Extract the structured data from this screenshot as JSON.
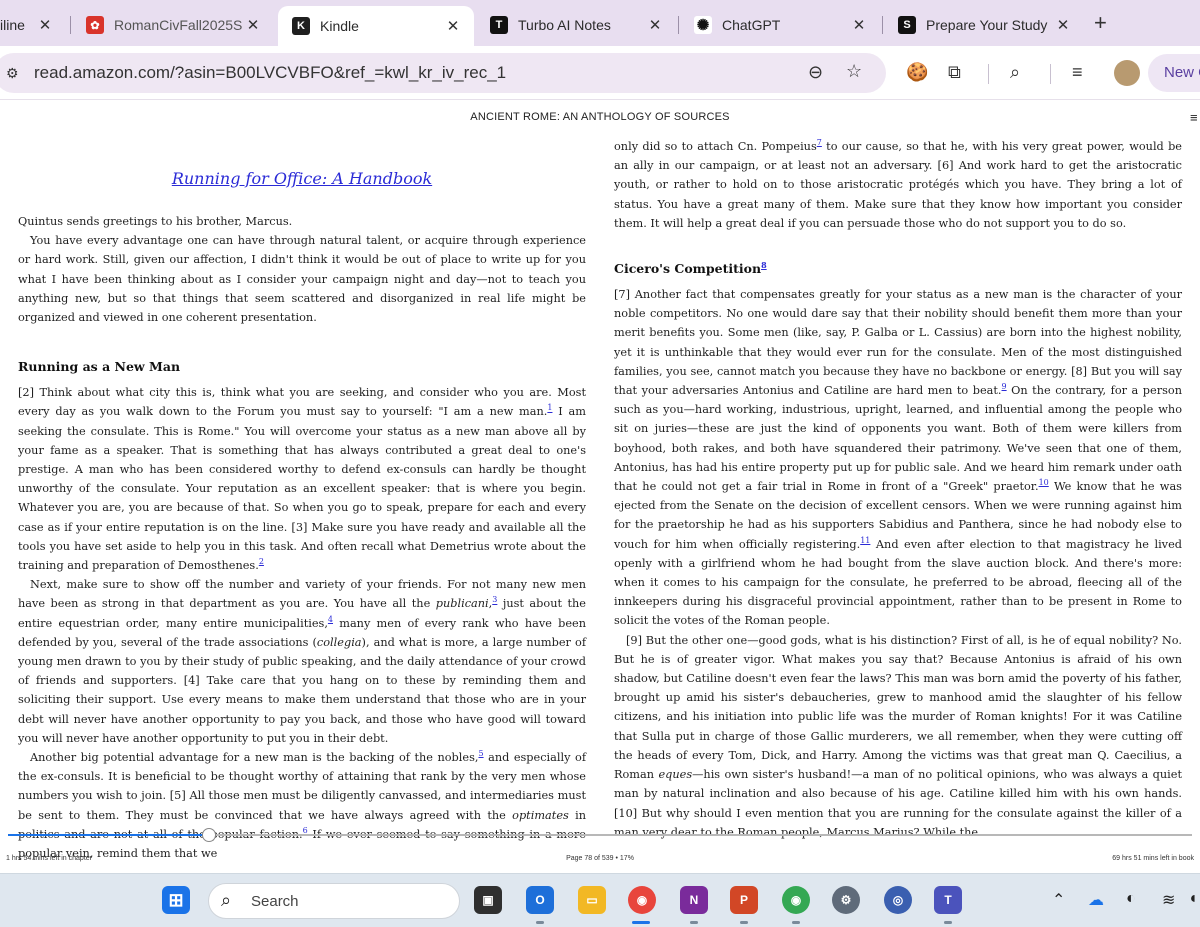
{
  "browser": {
    "tabs": [
      {
        "title": "iline",
        "fav": "",
        "fav_color": "#e8def0"
      },
      {
        "title": "RomanCivFall2025S",
        "fav": "✿",
        "fav_color": "#d9342b"
      },
      {
        "title": "Kindle",
        "fav": "K",
        "fav_color": "#1f1f1f"
      },
      {
        "title": "Turbo AI Notes",
        "fav": "T",
        "fav_color": "#111111"
      },
      {
        "title": "ChatGPT",
        "fav": "✺",
        "fav_color": "#ffffff"
      },
      {
        "title": "Prepare Your Study",
        "fav": "S",
        "fav_color": "#111111"
      }
    ],
    "url": "read.amazon.com/?asin=B00LVCVBFO&ref_=kwl_kr_iv_rec_1",
    "new_chat_label": "New C"
  },
  "reader": {
    "book_title": "ANCIENT ROME: AN ANTHOLOGY OF SOURCES",
    "chapter_title": "Running for Office: A Handbook",
    "left": {
      "p0": "Quintus sends greetings to his brother, Marcus.",
      "p1": "You have every advantage one can have through natural talent, or acquire through experience or hard work. Still, given our affection, I didn't think it would be out of place to write up for you what I have been thinking about as I consider your campaign night and day—not to teach you anything new, but so that things that seem scattered and disorganized in real life might be organized and viewed in one coherent presentation.",
      "h1": "Running as a New Man",
      "p2a": "[2] Think about what city this is, think what you are seeking, and consider who you are. Most every day as you walk down to the Forum you must say to yourself: \"I am a new man.",
      "fn1": "1",
      "p2b": " I am seeking the consulate. This is Rome.\" You will overcome your status as a new man above all by your fame as a speaker. That is something that has always contributed a great deal to one's prestige. A man who has been considered worthy to defend ex-consuls can hardly be thought unworthy of the consulate. Your reputation as an excellent speaker: that is where you begin. Whatever you are, you are because of that. So when you go to speak, prepare for each and every case as if your entire reputation is on the line. [3] Make sure you have ready and available all the tools you have set aside to help you in this task. And often recall what Demetrius wrote about the training and preparation of Demosthenes.",
      "fn2": "2",
      "p3a": "Next, make sure to show off the number and variety of your friends. For not many new men have been as strong in that department as you are. You have all the ",
      "p3i": "publicani",
      "p3b": ",",
      "fn3": "3",
      "p3c": " just about the entire equestrian order, many entire municipalities,",
      "fn4": "4",
      "p3d": " many men of every rank who have been defended by you, several of the trade associations (",
      "p3i2": "collegia",
      "p3e": "), and what is more, a large number of young men drawn to you by their study of public speaking, and the daily attendance of your crowd of friends and supporters. [4] Take care that you hang on to these by reminding them and soliciting their support. Use every means to make them understand that those who are in your debt will never have another opportunity to pay you back, and those who have good will toward you will never have another opportunity to put you in their debt.",
      "p4a": "Another big potential advantage for a new man is the backing of the nobles,",
      "fn5": "5",
      "p4b": " and especially of the ex-consuls. It is beneficial to be thought worthy of attaining that rank by the very men whose numbers you wish to join. [5] All those men must be diligently canvassed, and intermediaries must be sent to them. They must be convinced that we have always agreed with the ",
      "p4i": "optimates",
      "p4c": " in politics and are not at all of the popular faction.",
      "fn6": "6",
      "p4d": " If we ever seemed to say something in a more popular vein, remind them that we"
    },
    "right": {
      "p0a": "only did so to attach Cn. Pompeius",
      "fn7": "7",
      "p0b": " to our cause, so that he, with his very great power, would be an ally in our campaign, or at least not an adversary. [6] And work hard to get the aristocratic youth, or rather to hold on to those aristocratic protégés which you have. They bring a lot of status. You have a great many of them. Make sure that they know how important you consider them. It will help a great deal if you can persuade those who do not support you to do so.",
      "h1": "Cicero's Competition",
      "fn8": "8",
      "p1a": "[7] Another fact that compensates greatly for your status as a new man is the character of your noble competitors. No one would dare say that their nobility should benefit them more than your merit benefits you. Some men (like, say, P. Galba or L. Cassius) are born into the highest nobility, yet it is unthinkable that they would ever run for the consulate. Men of the most distinguished families, you see, cannot match you because they have no backbone or energy. [8] But you will say that your adversaries Antonius and Catiline are hard men to beat.",
      "fn9": "9",
      "p1b": " On the contrary, for a person such as you—hard working, industrious, upright, learned, and influential among the people who sit on juries—these are just the kind of opponents you want. Both of them were killers from boyhood, both rakes, and both have squandered their patrimony. We've seen that one of them, Antonius, has had his entire property put up for public sale. And we heard him remark under oath that he could not get a fair trial in Rome in front of a \"Greek\" praetor.",
      "fn10": "10",
      "p1c": " We know that he was ejected from the Senate on the decision of excellent censors. When we were running against him for the praetorship he had as his supporters Sabidius and Panthera, since he had nobody else to vouch for him when officially registering.",
      "fn11": "11",
      "p1d": " And even after election to that magistracy he lived openly with a girlfriend whom he had bought from the slave auction block. And there's more: when it comes to his campaign for the consulate, he preferred to be abroad, fleecing all of the innkeepers during his disgraceful provincial appointment, rather than to be present in Rome to solicit the votes of the Roman people.",
      "p2a": "[9] But the other one—good gods, what is his distinction? First of all, is he of equal nobility? No. But he is of greater vigor. What makes you say that? Because Antonius is afraid of his own shadow, but Catiline doesn't even fear the laws? This man was born amid the poverty of his father, brought up amid his sister's debaucheries, grew to manhood amid the slaughter of his fellow citizens, and his initiation into public life was the murder of Roman knights! For it was Catiline that Sulla put in charge of those Gallic murderers, we all remember, when they were cutting off the heads of every Tom, Dick, and Harry. Among the victims was that great man Q. Caecilius, a Roman ",
      "p2i": "eques",
      "p2b": "—his own sister's husband!—a man of no political opinions, who was always a quiet man by natural inclination and also because of his age. Catiline killed him with his own hands. [10] But why should I even mention that you are running for the consulate against the killer of a man very dear to the Roman people, Marcus Marius? While the"
    },
    "footer": {
      "left": "1 hrs 54 mins left in chapter",
      "center": "Page 78 of 539 • 17%",
      "right": "69 hrs 51 mins left in book"
    },
    "progress": 0.17,
    "progress_color": "#1a73e8"
  },
  "taskbar": {
    "search_label": "Search"
  }
}
